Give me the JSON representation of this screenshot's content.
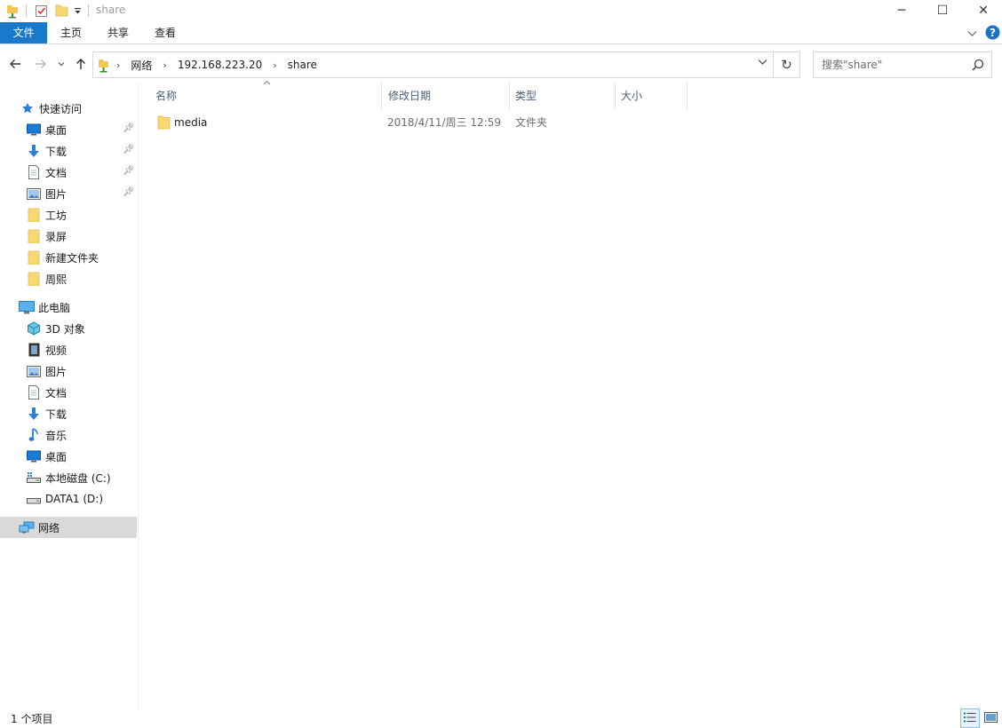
{
  "window": {
    "title": "share",
    "controls": {
      "minimize": "─",
      "maximize": "☐",
      "close": "✕"
    }
  },
  "ribbon": {
    "tabs": [
      {
        "label": "文件"
      },
      {
        "label": "主页"
      },
      {
        "label": "共享"
      },
      {
        "label": "查看"
      }
    ],
    "help": "?"
  },
  "address": {
    "crumbs": [
      "网络",
      "192.168.223.20",
      "share"
    ],
    "search_placeholder": "搜索\"share\""
  },
  "nav": {
    "quick_access": "快速访问",
    "quick_items": [
      {
        "label": "桌面",
        "icon": "desktop-icon",
        "pinned": true
      },
      {
        "label": "下载",
        "icon": "download-icon",
        "pinned": true
      },
      {
        "label": "文档",
        "icon": "document-icon",
        "pinned": true
      },
      {
        "label": "图片",
        "icon": "picture-icon",
        "pinned": true
      },
      {
        "label": "工坊",
        "icon": "folder-icon",
        "pinned": false
      },
      {
        "label": "录屏",
        "icon": "folder-icon",
        "pinned": false
      },
      {
        "label": "新建文件夹",
        "icon": "folder-icon",
        "pinned": false
      },
      {
        "label": "周熙",
        "icon": "folder-icon",
        "pinned": false
      }
    ],
    "this_pc": "此电脑",
    "pc_items": [
      {
        "label": "3D 对象",
        "icon": "3d-objects-icon"
      },
      {
        "label": "视频",
        "icon": "video-icon"
      },
      {
        "label": "图片",
        "icon": "picture-icon"
      },
      {
        "label": "文档",
        "icon": "document-icon"
      },
      {
        "label": "下载",
        "icon": "download-icon"
      },
      {
        "label": "音乐",
        "icon": "music-icon"
      },
      {
        "label": "桌面",
        "icon": "desktop-icon"
      },
      {
        "label": "本地磁盘 (C:)",
        "icon": "drive-icon"
      },
      {
        "label": "DATA1 (D:)",
        "icon": "drive-icon"
      }
    ],
    "network": "网络"
  },
  "columns": {
    "name": "名称",
    "modified": "修改日期",
    "type": "类型",
    "size": "大小"
  },
  "files": [
    {
      "name": "media",
      "modified": "2018/4/11/周三 12:59",
      "type": "文件夹",
      "size": ""
    }
  ],
  "status": {
    "count": "1 个项目"
  },
  "colors": {
    "accent": "#1979ca",
    "folder": "#f8d775",
    "selection": "#d9d9d9"
  }
}
